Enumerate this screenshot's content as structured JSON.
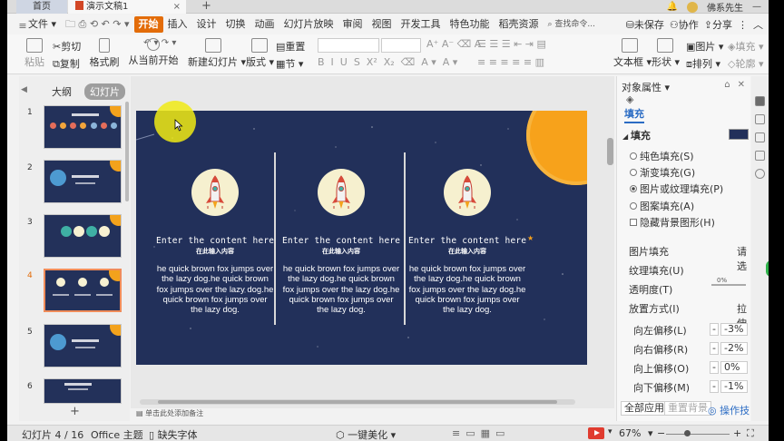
{
  "titlebar": {
    "home_tab": "首页",
    "doc_tab": "演示文稿1",
    "add_tab": "+",
    "user": "佛系先生"
  },
  "menubar": {
    "file": "文件",
    "items": [
      "开始",
      "插入",
      "设计",
      "切换",
      "动画",
      "幻灯片放映",
      "审阅",
      "视图",
      "开发工具",
      "特色功能",
      "稻壳资源"
    ],
    "search": "查找命令...",
    "unsaved": "未保存",
    "collab": "协作",
    "share": "分享"
  },
  "ribbon": {
    "paste": "粘贴",
    "cut": "剪切",
    "copy": "复制",
    "format_painter": "格式刷",
    "from_current": "从当前开始",
    "new_slide": "新建幻灯片",
    "layout": "版式",
    "reset": "重置",
    "section": "节",
    "textbox": "文本框",
    "shape": "形状",
    "image": "图片",
    "fill": "填充",
    "arrange": "排列",
    "outline": "轮廓"
  },
  "leftpanel": {
    "tab_outline": "大纲",
    "tab_slides": "幻灯片",
    "slide_numbers": [
      "1",
      "2",
      "3",
      "4",
      "5",
      "6"
    ],
    "add": "+"
  },
  "slide": {
    "columns": [
      {
        "en": "Enter the content here",
        "cn": "在此输入内容",
        "body": "he quick brown fox jumps over the lazy dog.he quick brown fox jumps over the lazy dog.he quick brown fox jumps over the lazy dog."
      },
      {
        "en": "Enter the content here",
        "cn": "在此输入内容",
        "body": "he quick brown fox jumps over the lazy dog.he quick brown fox jumps over the lazy dog.he quick brown fox jumps over the lazy dog."
      },
      {
        "en": "Enter the content here",
        "cn": "在此输入内容",
        "body": "he quick brown fox jumps over the lazy dog.he quick brown fox jumps over the lazy dog.he quick brown fox jumps over the lazy dog."
      }
    ],
    "notes": "单击此处添加备注",
    "colors": {
      "background": "#22305a",
      "sun": "#f7a21b",
      "accent": "#e36c09"
    }
  },
  "rightpanel": {
    "title": "对象属性",
    "tab": "填充",
    "section": "填充",
    "options": [
      "纯色填充(S)",
      "渐变填充(G)",
      "图片或纹理填充(P)",
      "图案填充(A)"
    ],
    "selected_option": "图片或纹理填充(P)",
    "hide_bg": "隐藏背景图形(H)",
    "picture_fill": "图片填充",
    "picture_fill_value": "请选",
    "texture_fill": "纹理填充(U)",
    "transparency": "透明度(T)",
    "transparency_value": "0%",
    "placement": "放置方式(I)",
    "placement_value": "拉伸",
    "offsets": [
      {
        "label": "向左偏移(L)",
        "value": "-3%"
      },
      {
        "label": "向右偏移(R)",
        "value": "-2%"
      },
      {
        "label": "向上偏移(O)",
        "value": "0%"
      },
      {
        "label": "向下偏移(M)",
        "value": "-1%"
      }
    ],
    "apply_all": "全部应用",
    "reset_bg": "重置背景",
    "tips": "操作技"
  },
  "statusbar": {
    "slide_info": "幻灯片 4 / 16",
    "theme": "Office 主题",
    "missing_font": "缺失字体",
    "beautify": "一键美化",
    "zoom": "67%",
    "minus": "−",
    "plus": "+"
  }
}
